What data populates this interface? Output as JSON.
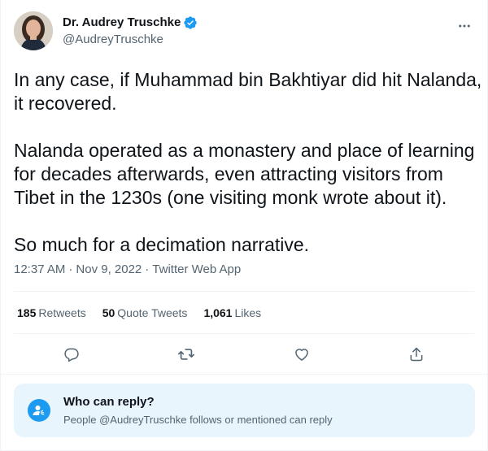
{
  "author": {
    "display_name": "Dr. Audrey Truschke",
    "handle": "@AudreyTruschke",
    "verified": true
  },
  "tweet": {
    "paragraphs": [
      "In any case, if Muhammad bin Bakhtiyar did hit Nalanda, it recovered.",
      "Nalanda operated as a monastery and place of learning for decades afterwards, even attracting visitors from Tibet in the 1230s (one visiting monk wrote about it).",
      "So much for a decimation narrative."
    ],
    "time": "12:37 AM",
    "separator": "·",
    "date": "Nov 9, 2022",
    "source": "Twitter Web App"
  },
  "stats": {
    "retweets_count": "185",
    "retweets_label": "Retweets",
    "quotes_count": "50",
    "quotes_label": "Quote Tweets",
    "likes_count": "1,061",
    "likes_label": "Likes"
  },
  "actions": [
    "reply-icon",
    "retweet-icon",
    "like-icon",
    "share-icon"
  ],
  "reply_restriction": {
    "title": "Who can reply?",
    "subtitle": "People @AudreyTruschke follows or mentioned can reply"
  },
  "colors": {
    "accent": "#1d9bf0",
    "text": "#0f1419",
    "secondary": "#536471",
    "reply_box_bg": "#e8f5fd",
    "divider": "#eff3f4"
  }
}
